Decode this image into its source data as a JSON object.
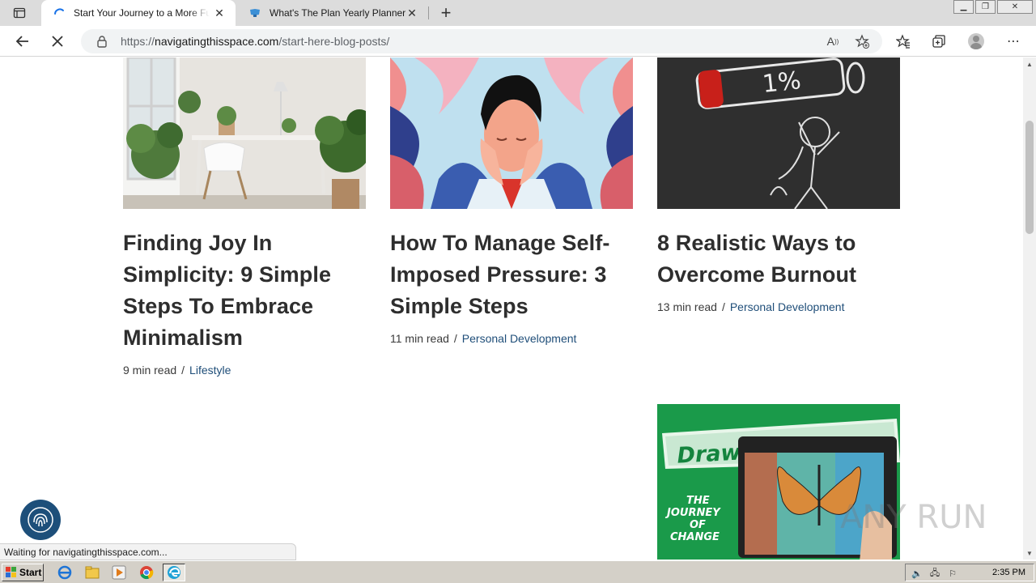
{
  "browser": {
    "tabs": [
      {
        "title": "Start Your Journey to a More Fu",
        "active": true
      },
      {
        "title": "What's The Plan Yearly Planner",
        "active": false
      }
    ],
    "url": {
      "scheme": "https://",
      "host": "navigatingthisspace.com",
      "path": "/start-here-blog-posts/"
    }
  },
  "posts": [
    {
      "title": "Finding Joy In Simplicity: 9 Simple Steps To Embrace Minimalism",
      "read_time": "9 min read",
      "separator": "/",
      "category": "Lifestyle"
    },
    {
      "title": "How To Manage Self-Imposed Pressure: 3 Simple Steps",
      "read_time": "11 min read",
      "separator": "/",
      "category": "Personal Development"
    },
    {
      "title": "8 Realistic Ways to Overcome Burnout",
      "read_time": "13 min read",
      "separator": "/",
      "category": "Personal Development"
    }
  ],
  "burnout_image": {
    "battery_text": "1%"
  },
  "promo": {
    "headline": "Draw With Me",
    "subtitle_lines": [
      "THE",
      "JOURNEY",
      "OF",
      "CHANGE"
    ]
  },
  "status_text": "Waiting for navigatingthisspace.com...",
  "watermark": "ANY RUN",
  "taskbar": {
    "start_label": "Start",
    "clock": "2:35 PM"
  },
  "colors": {
    "link": "#1f4e79",
    "title": "#2e2e2e",
    "promo_green": "#1a9a4a",
    "fab_blue": "#1d4f7a"
  }
}
